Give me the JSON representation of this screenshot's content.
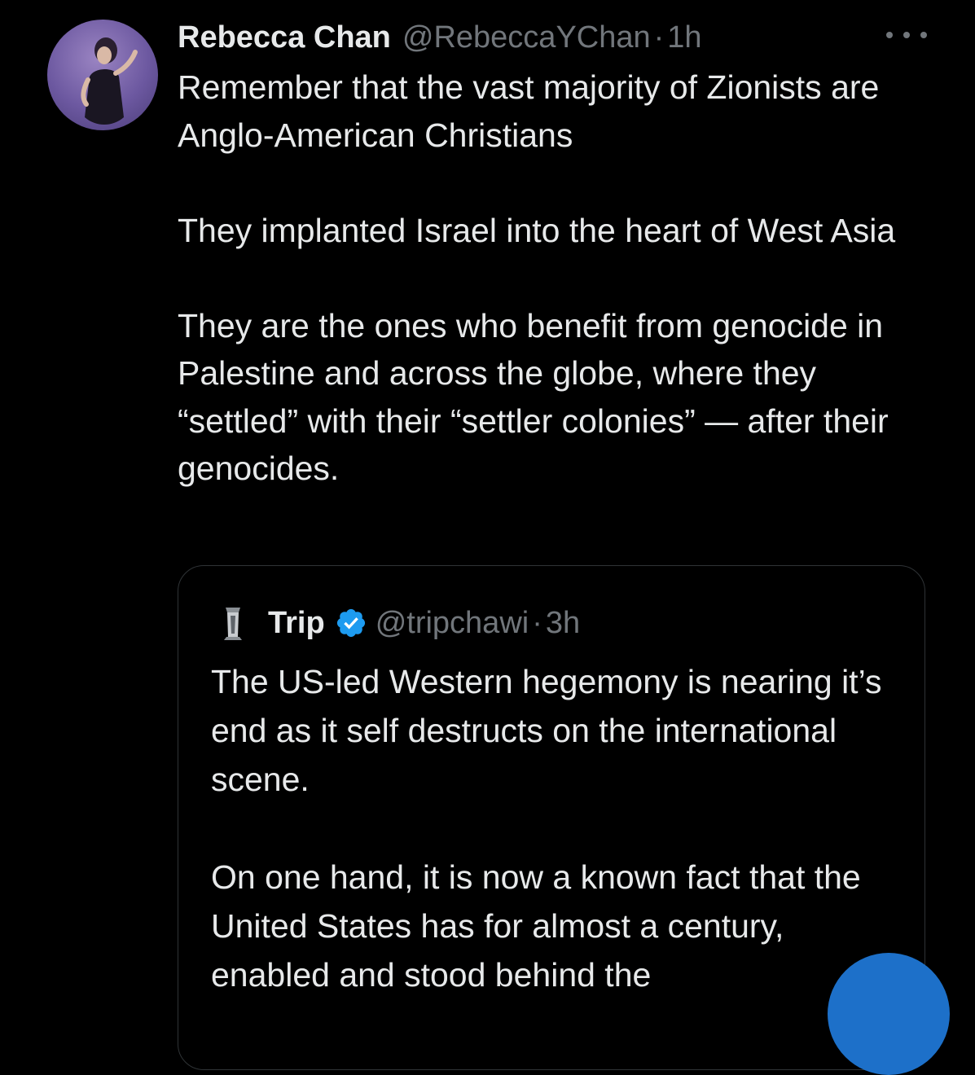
{
  "tweet": {
    "author_name": "Rebecca Chan",
    "author_handle": "@RebeccaYChan",
    "separator": "·",
    "time": "1h",
    "paragraphs": [
      "Remember that the vast majority of Zionists are Anglo-American Christians",
      "They implanted Israel into the heart of West Asia",
      "They are the ones who benefit from genocide in Palestine and across the globe, where they “settled” with their “settler colonies” — after their genocides."
    ]
  },
  "quoted_tweet": {
    "author_name": "Trip",
    "author_handle": "@tripchawi",
    "separator": "·",
    "time": "3h",
    "verified": true,
    "paragraphs": [
      "The US-led Western hegemony is nearing it’s end as it self destructs on the international scene.",
      "On one hand, it is now a known fact that the United States has for almost a century, enabled and stood behind the"
    ]
  },
  "icons": {
    "more": "more-horizontal-icon",
    "verified": "verified-badge-icon"
  },
  "colors": {
    "background": "#000000",
    "text": "#e7e9ea",
    "secondary_text": "#71767b",
    "verified": "#1d9bf0",
    "border": "#2f3336"
  }
}
